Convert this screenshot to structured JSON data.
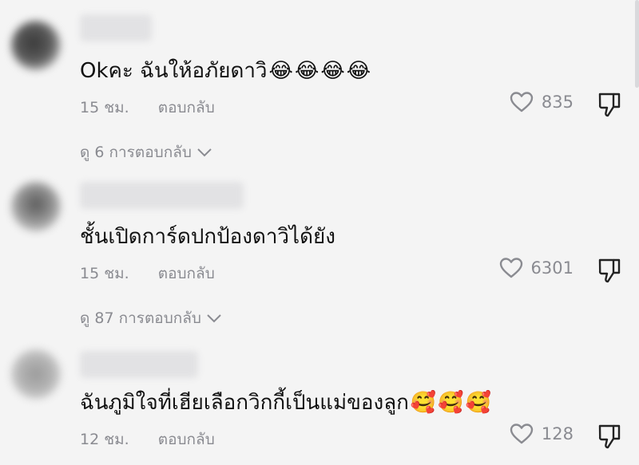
{
  "comments": [
    {
      "text": "Okคะ ฉันให้อภัยดาวิ",
      "emojis": [
        "😂",
        "😂",
        "😂",
        "😂"
      ],
      "time": "15 ชม.",
      "reply_label": "ตอบกลับ",
      "likes": "835",
      "view_replies": "ดู 6 การตอบกลับ"
    },
    {
      "text": "ชั้นเปิดการ์ดปกป้องดาวิได้ยัง",
      "emojis": [],
      "time": "15 ชม.",
      "reply_label": "ตอบกลับ",
      "likes": "6301",
      "view_replies": "ดู 87 การตอบกลับ"
    },
    {
      "text": "ฉันภูมิใจที่เฮียเลือกวิกกี้เป็นแม่ของลูก",
      "emojis": [
        "🥰",
        "🥰",
        "🥰"
      ],
      "time": "12 ชม.",
      "reply_label": "ตอบกลับ",
      "likes": "128"
    }
  ],
  "colors": {
    "background": "#f4f4f4",
    "text": "#111111",
    "muted": "#8a8b91"
  },
  "icons": [
    "heart-outline-icon",
    "thumbs-down-icon",
    "chevron-down-icon"
  ]
}
